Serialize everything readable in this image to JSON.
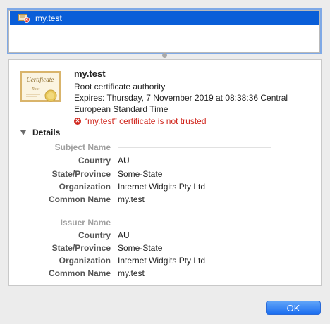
{
  "list": {
    "selected_label": "my.test"
  },
  "cert": {
    "name": "my.test",
    "type": "Root certificate authority",
    "expires": "Expires: Thursday, 7 November 2019 at 08:38:36 Central European Standard Time",
    "warning": "“my.test” certificate is not trusted"
  },
  "details_label": "Details",
  "subject": {
    "section_label": "Subject Name",
    "fields": [
      {
        "key": "Country",
        "value": "AU"
      },
      {
        "key": "State/Province",
        "value": "Some-State"
      },
      {
        "key": "Organization",
        "value": "Internet Widgits Pty Ltd"
      },
      {
        "key": "Common Name",
        "value": "my.test"
      }
    ]
  },
  "issuer": {
    "section_label": "Issuer Name",
    "fields": [
      {
        "key": "Country",
        "value": "AU"
      },
      {
        "key": "State/Province",
        "value": "Some-State"
      },
      {
        "key": "Organization",
        "value": "Internet Widgits Pty Ltd"
      },
      {
        "key": "Common Name",
        "value": "my.test"
      }
    ]
  },
  "ok_label": "OK",
  "colors": {
    "selection": "#0a5ed8",
    "warning": "#d0261d"
  }
}
